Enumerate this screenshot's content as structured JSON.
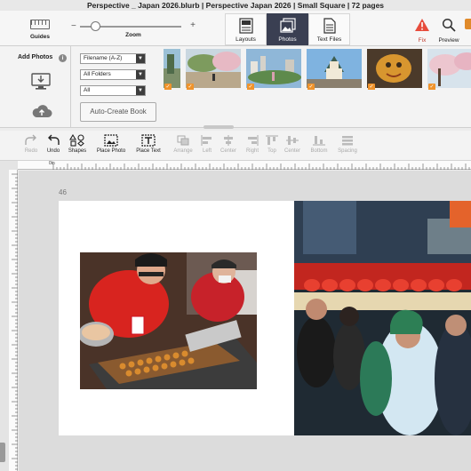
{
  "window": {
    "title": "Perspective _ Japan 2026.blurb | Perspective  Japan 2026 | Small Square | 72 pages"
  },
  "topbar": {
    "guides_label": "Guides",
    "zoom_label": "Zoom",
    "zoom_minus": "−",
    "zoom_plus": "+",
    "zoom_level": 0.15,
    "tabs": [
      {
        "label": "Layouts",
        "icon": "layouts-icon",
        "active": false
      },
      {
        "label": "Photos",
        "icon": "photos-icon",
        "active": true
      },
      {
        "label": "Text Files",
        "icon": "text-files-icon",
        "active": false
      }
    ],
    "fix_label": "Fix",
    "preview_label": "Preview",
    "fix_icon": "warning-icon",
    "preview_icon": "magnifier-icon"
  },
  "photo_panel": {
    "add_photos_label": "Add Photos",
    "info_glyph": "i",
    "sort_select": "Filename (A-Z)",
    "folder_select": "All Folders",
    "filter_select": "All",
    "auto_create_label": "Auto-Create Book",
    "check_glyph": "✓",
    "thumbnails": [
      {
        "subject": "street trees",
        "used": true
      },
      {
        "subject": "park with cherry blossoms",
        "used": true
      },
      {
        "subject": "city skyline",
        "used": true
      },
      {
        "subject": "castle",
        "used": true
      },
      {
        "subject": "lion statue",
        "used": true
      },
      {
        "subject": "cherry blossoms",
        "used": true
      }
    ]
  },
  "toolbar": {
    "items": [
      {
        "label": "Redo",
        "enabled": false
      },
      {
        "label": "Undo",
        "enabled": true
      },
      {
        "label": "Shapes",
        "enabled": true
      },
      {
        "label": "Place Photo",
        "enabled": true
      },
      {
        "label": "Place Text",
        "enabled": true
      },
      {
        "label": "Arrange",
        "enabled": false
      },
      {
        "label": "Left",
        "enabled": false
      },
      {
        "label": "Center",
        "enabled": false
      },
      {
        "label": "Right",
        "enabled": false
      },
      {
        "label": "Top",
        "enabled": false
      },
      {
        "label": "Center",
        "enabled": false
      },
      {
        "label": "Bottom",
        "enabled": false
      },
      {
        "label": "Spacing",
        "enabled": false
      }
    ]
  },
  "ruler": {
    "origin_label": "0in"
  },
  "canvas": {
    "page_number": "46"
  },
  "colors": {
    "active_tab": "#3a3f52",
    "accent_orange": "#f0932b",
    "warning_red": "#e74c3c"
  }
}
